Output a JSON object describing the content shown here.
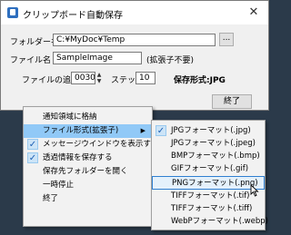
{
  "window": {
    "title": "クリップボード自動保存",
    "close_glyph": "✕",
    "folder_label": "フォルダー名",
    "folder_value": "C:¥MyDoc¥Temp",
    "browse_label": "...",
    "file_label": "ファイル名",
    "file_value": "SampleImage",
    "ext_note": "(拡張子不要)",
    "counter_label": "ファイルの追番",
    "counter_value": "0030",
    "step_label": "ステップ",
    "step_value": "10",
    "format_status": "保存形式:JPG",
    "close_button": "終了"
  },
  "context_menu": {
    "items": [
      {
        "label": "通知領域に格納",
        "checked": false
      },
      {
        "label": "ファイル形式(拡張子)",
        "checked": false,
        "submenu": true
      },
      {
        "label": "メッセージウインドウを表示する",
        "checked": true
      },
      {
        "label": "透過情報を保存する",
        "checked": true
      },
      {
        "label": "保存先フォルダーを開く",
        "checked": false
      },
      {
        "label": "一時停止",
        "checked": false
      },
      {
        "label": "終了",
        "checked": false
      }
    ]
  },
  "submenu": {
    "items": [
      {
        "label": "JPGフォーマット(.jpg)",
        "checked": true
      },
      {
        "label": "JPGフォーマット(.jpeg)",
        "checked": false
      },
      {
        "label": "BMPフォーマット(.bmp)",
        "checked": false
      },
      {
        "label": "GIFフォーマット(.gif)",
        "checked": false
      },
      {
        "label": "PNGフォーマット(.png)",
        "checked": false
      },
      {
        "label": "TIFFフォーマット(.tif)",
        "checked": false
      },
      {
        "label": "TIFFフォーマット(.tiff)",
        "checked": false
      },
      {
        "label": "WebPフォーマット(.webp)",
        "checked": false
      }
    ]
  },
  "colors": {
    "highlight": "#91c9f7",
    "check": "#1e5fb3"
  }
}
